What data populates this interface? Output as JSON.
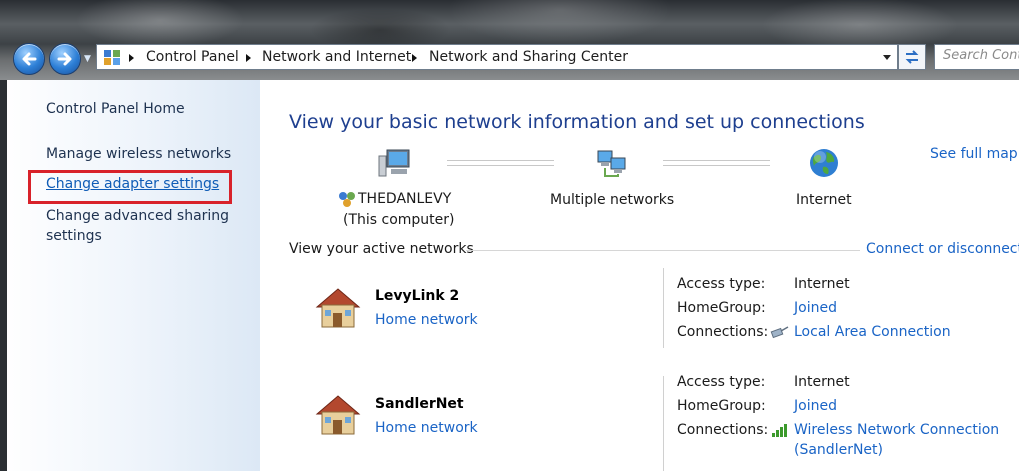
{
  "breadcrumb": [
    "Control Panel",
    "Network and Internet",
    "Network and Sharing Center"
  ],
  "search": {
    "placeholder": "Search Cont"
  },
  "sidebar": {
    "items": [
      {
        "label": "Control Panel Home"
      },
      {
        "label": "Manage wireless networks"
      },
      {
        "label": "Change adapter settings"
      },
      {
        "label": "Change advanced sharing settings"
      }
    ]
  },
  "main": {
    "title": "View your basic network information and set up connections",
    "see_full_map": "See full map",
    "map": {
      "computer_name": "THEDANLEVY",
      "computer_sub": "(This computer)",
      "middle": "Multiple networks",
      "internet": "Internet"
    },
    "active_header": "View your active networks",
    "connect_link": "Connect or disconnect",
    "networks": [
      {
        "name": "LevyLink  2",
        "type": "Home network",
        "access_label": "Access type:",
        "access_value": "Internet",
        "homegroup_label": "HomeGroup:",
        "homegroup_value": "Joined",
        "connections_label": "Connections:",
        "connection_value": "Local Area Connection"
      },
      {
        "name": "SandlerNet",
        "type": "Home network",
        "access_label": "Access type:",
        "access_value": "Internet",
        "homegroup_label": "HomeGroup:",
        "homegroup_value": "Joined",
        "connections_label": "Connections:",
        "connection_value": "Wireless Network Connection",
        "connection_value_2": "(SandlerNet)"
      }
    ]
  },
  "colors": {
    "link": "#1a64c6",
    "title": "#1e3f8f",
    "highlight_box": "#d8222a"
  }
}
